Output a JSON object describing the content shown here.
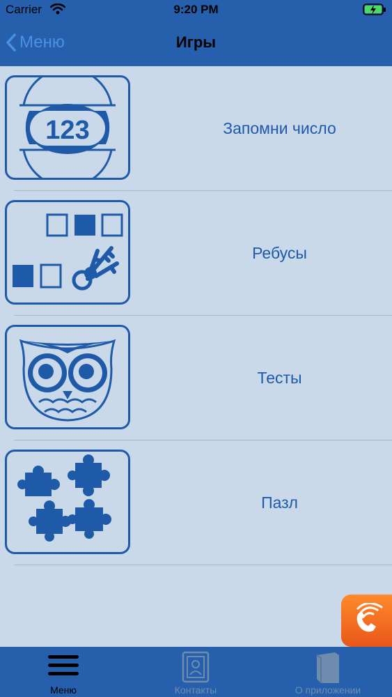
{
  "status": {
    "carrier": "Carrier",
    "time": "9:20 PM"
  },
  "nav": {
    "back_label": "Меню",
    "title": "Игры"
  },
  "games": [
    {
      "label": "Запомни число",
      "icon": "number-123-icon",
      "icon_text": "123"
    },
    {
      "label": "Ребусы",
      "icon": "rebus-keys-icon"
    },
    {
      "label": "Тесты",
      "icon": "owl-icon"
    },
    {
      "label": "Пазл",
      "icon": "puzzle-icon"
    }
  ],
  "tabs": [
    {
      "label": "Меню",
      "icon": "hamburger-menu-icon",
      "active": true
    },
    {
      "label": "Контакты",
      "icon": "contacts-icon",
      "active": false
    },
    {
      "label": "О приложении",
      "icon": "book-icon",
      "active": false
    }
  ],
  "colors": {
    "nav_bg": "#2660ac",
    "content_bg": "#c9d9ea",
    "accent": "#1e5aa8",
    "fab": "#f26b22"
  }
}
